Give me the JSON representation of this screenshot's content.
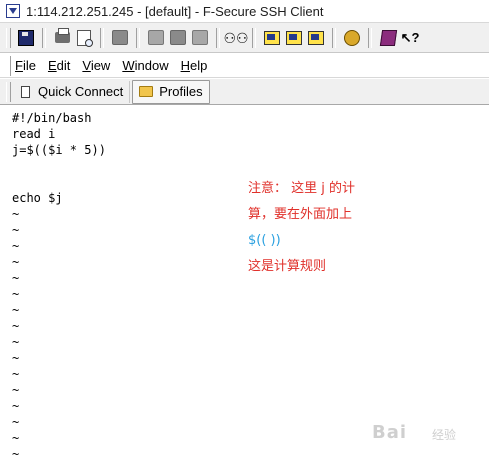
{
  "window": {
    "title": "1:114.212.251.245 - [default] - F-Secure SSH Client"
  },
  "toolbar": {
    "icons": [
      "save-icon",
      "print-icon",
      "print-preview-icon",
      "copy-icon",
      "paste-icon",
      "cut-icon",
      "find-icon",
      "new-terminal-icon",
      "file-transfer-icon",
      "session-icon",
      "settings-icon",
      "help-book-icon",
      "context-help-icon"
    ]
  },
  "menu": {
    "items": [
      "File",
      "Edit",
      "View",
      "Window",
      "Help"
    ]
  },
  "quickbar": {
    "quick_connect": "Quick Connect",
    "profiles": "Profiles"
  },
  "terminal": {
    "lines": [
      "#!/bin/bash",
      "read i",
      "j=$(($i * 5))",
      "",
      "",
      "echo $j",
      "~",
      "~",
      "~",
      "~",
      "~",
      "~",
      "~",
      "~",
      "~",
      "~",
      "~",
      "~",
      "~",
      "~",
      "~",
      "~"
    ]
  },
  "annotation": {
    "line1": "注意： 这里 j 的计",
    "line2": "算，要在外面加上",
    "line3": "$(( ))",
    "line4": "这是计算规则"
  },
  "watermark": {
    "main": "Bai",
    "sub": "经验"
  },
  "colors": {
    "annotation_red": "#e0302a",
    "annotation_blue": "#2aa0e0"
  }
}
